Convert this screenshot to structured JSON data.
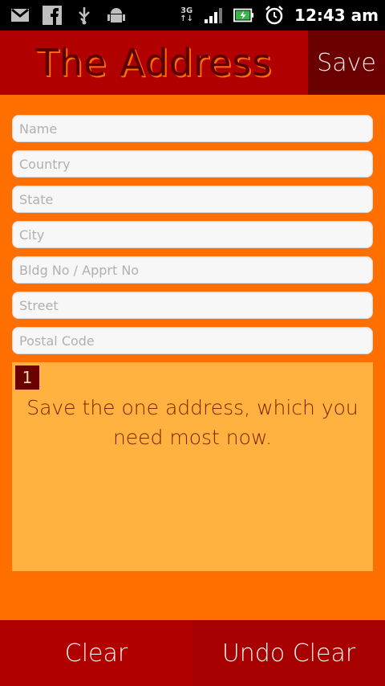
{
  "status_bar": {
    "time": "12:43 am",
    "network": "3G",
    "icons": [
      "gmail-icon",
      "facebook-icon",
      "usb-icon",
      "android-debug-icon",
      "3g-data-icon",
      "signal-icon",
      "battery-charging-icon",
      "alarm-icon"
    ]
  },
  "header": {
    "title": "The Address",
    "save_label": "Save"
  },
  "form": {
    "fields": [
      {
        "name": "name",
        "placeholder": "Name",
        "value": ""
      },
      {
        "name": "country",
        "placeholder": "Country",
        "value": ""
      },
      {
        "name": "state",
        "placeholder": "State",
        "value": ""
      },
      {
        "name": "city",
        "placeholder": "City",
        "value": ""
      },
      {
        "name": "building",
        "placeholder": "Bldg No / Apprt No",
        "value": ""
      },
      {
        "name": "street",
        "placeholder": "Street",
        "value": ""
      },
      {
        "name": "postal",
        "placeholder": "Postal Code",
        "value": ""
      }
    ]
  },
  "note": {
    "badge": "1",
    "text": "Save the one address, which you need most now."
  },
  "footer": {
    "clear_label": "Clear",
    "undo_clear_label": "Undo Clear"
  },
  "colors": {
    "background": "#ff6f00",
    "title_bar": "#b00000",
    "save_button": "#6b0000",
    "note_card": "#ffb23f",
    "bottom_bar": "#b10000"
  }
}
